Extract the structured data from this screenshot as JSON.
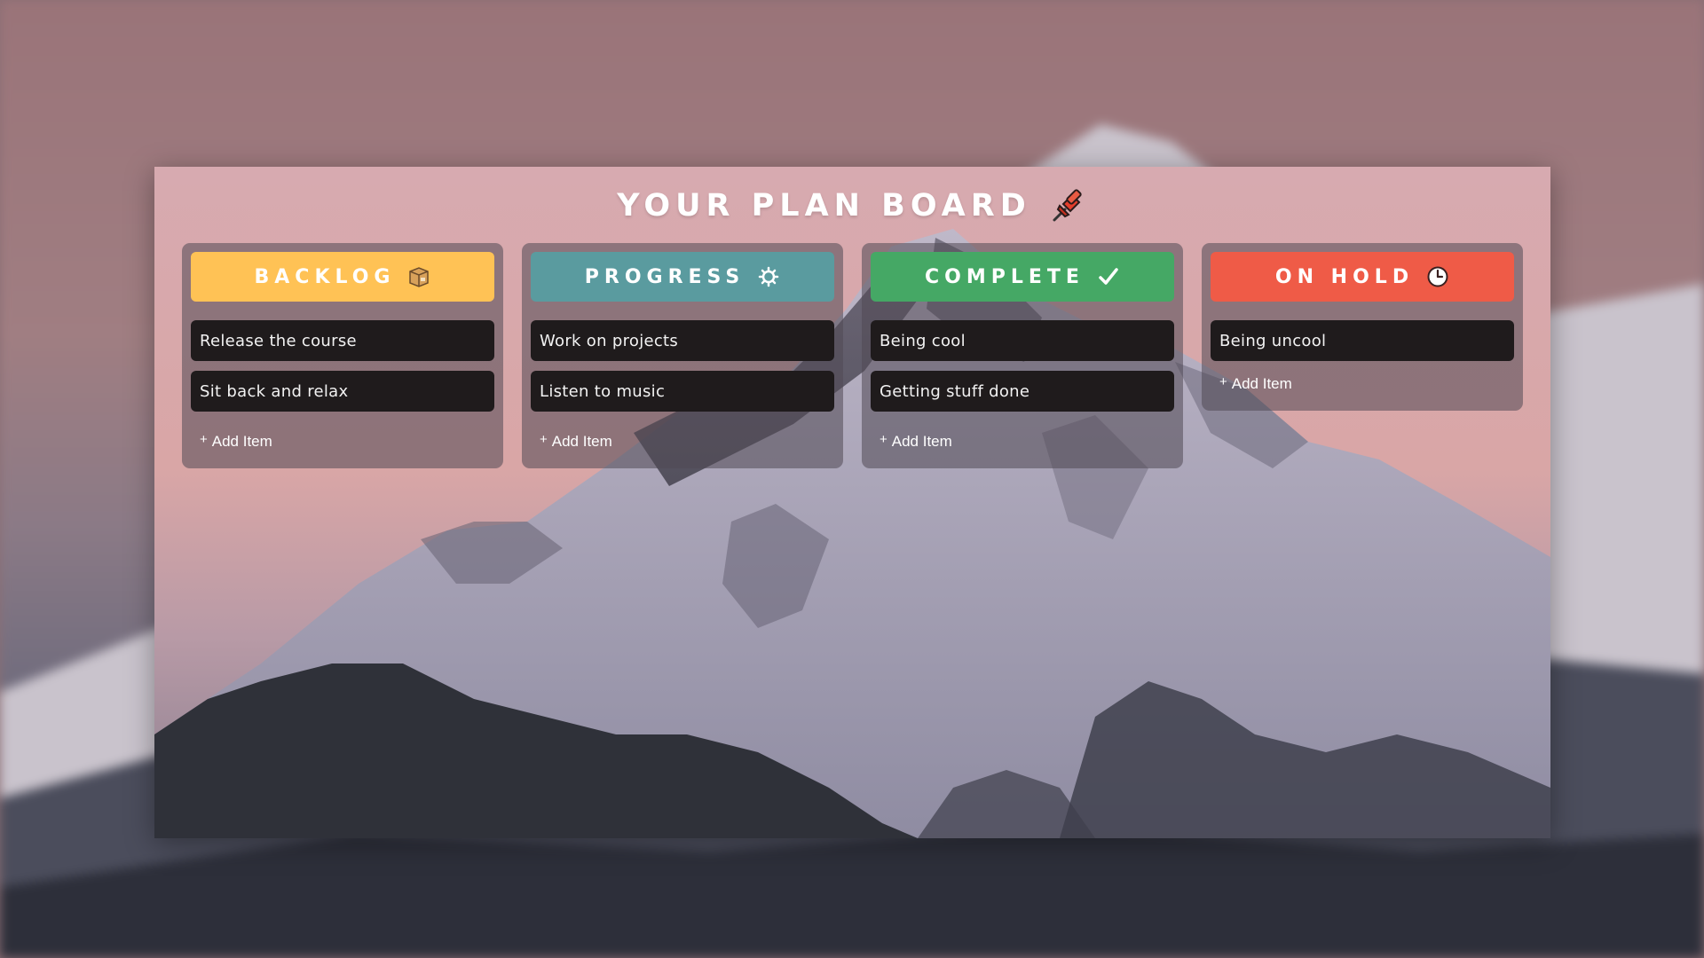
{
  "board": {
    "title": "YOUR PLAN BOARD",
    "title_icon": "pushpin-icon"
  },
  "columns": [
    {
      "title": "BACKLOG",
      "icon": "package-icon",
      "color": "#ffc255",
      "items": [
        "Release the course",
        "Sit back and relax"
      ],
      "add_label": "Add Item"
    },
    {
      "title": "PROGRESS",
      "icon": "gear-icon",
      "color": "#5a9b9f",
      "items": [
        "Work on projects",
        "Listen to music"
      ],
      "add_label": "Add Item"
    },
    {
      "title": "COMPLETE",
      "icon": "checkmark-icon",
      "color": "#45a865",
      "items": [
        "Being cool",
        "Getting stuff done"
      ],
      "add_label": "Add Item"
    },
    {
      "title": "ON HOLD",
      "icon": "clock-icon",
      "color": "#ef5b47",
      "items": [
        "Being uncool"
      ],
      "add_label": "Add Item"
    }
  ]
}
